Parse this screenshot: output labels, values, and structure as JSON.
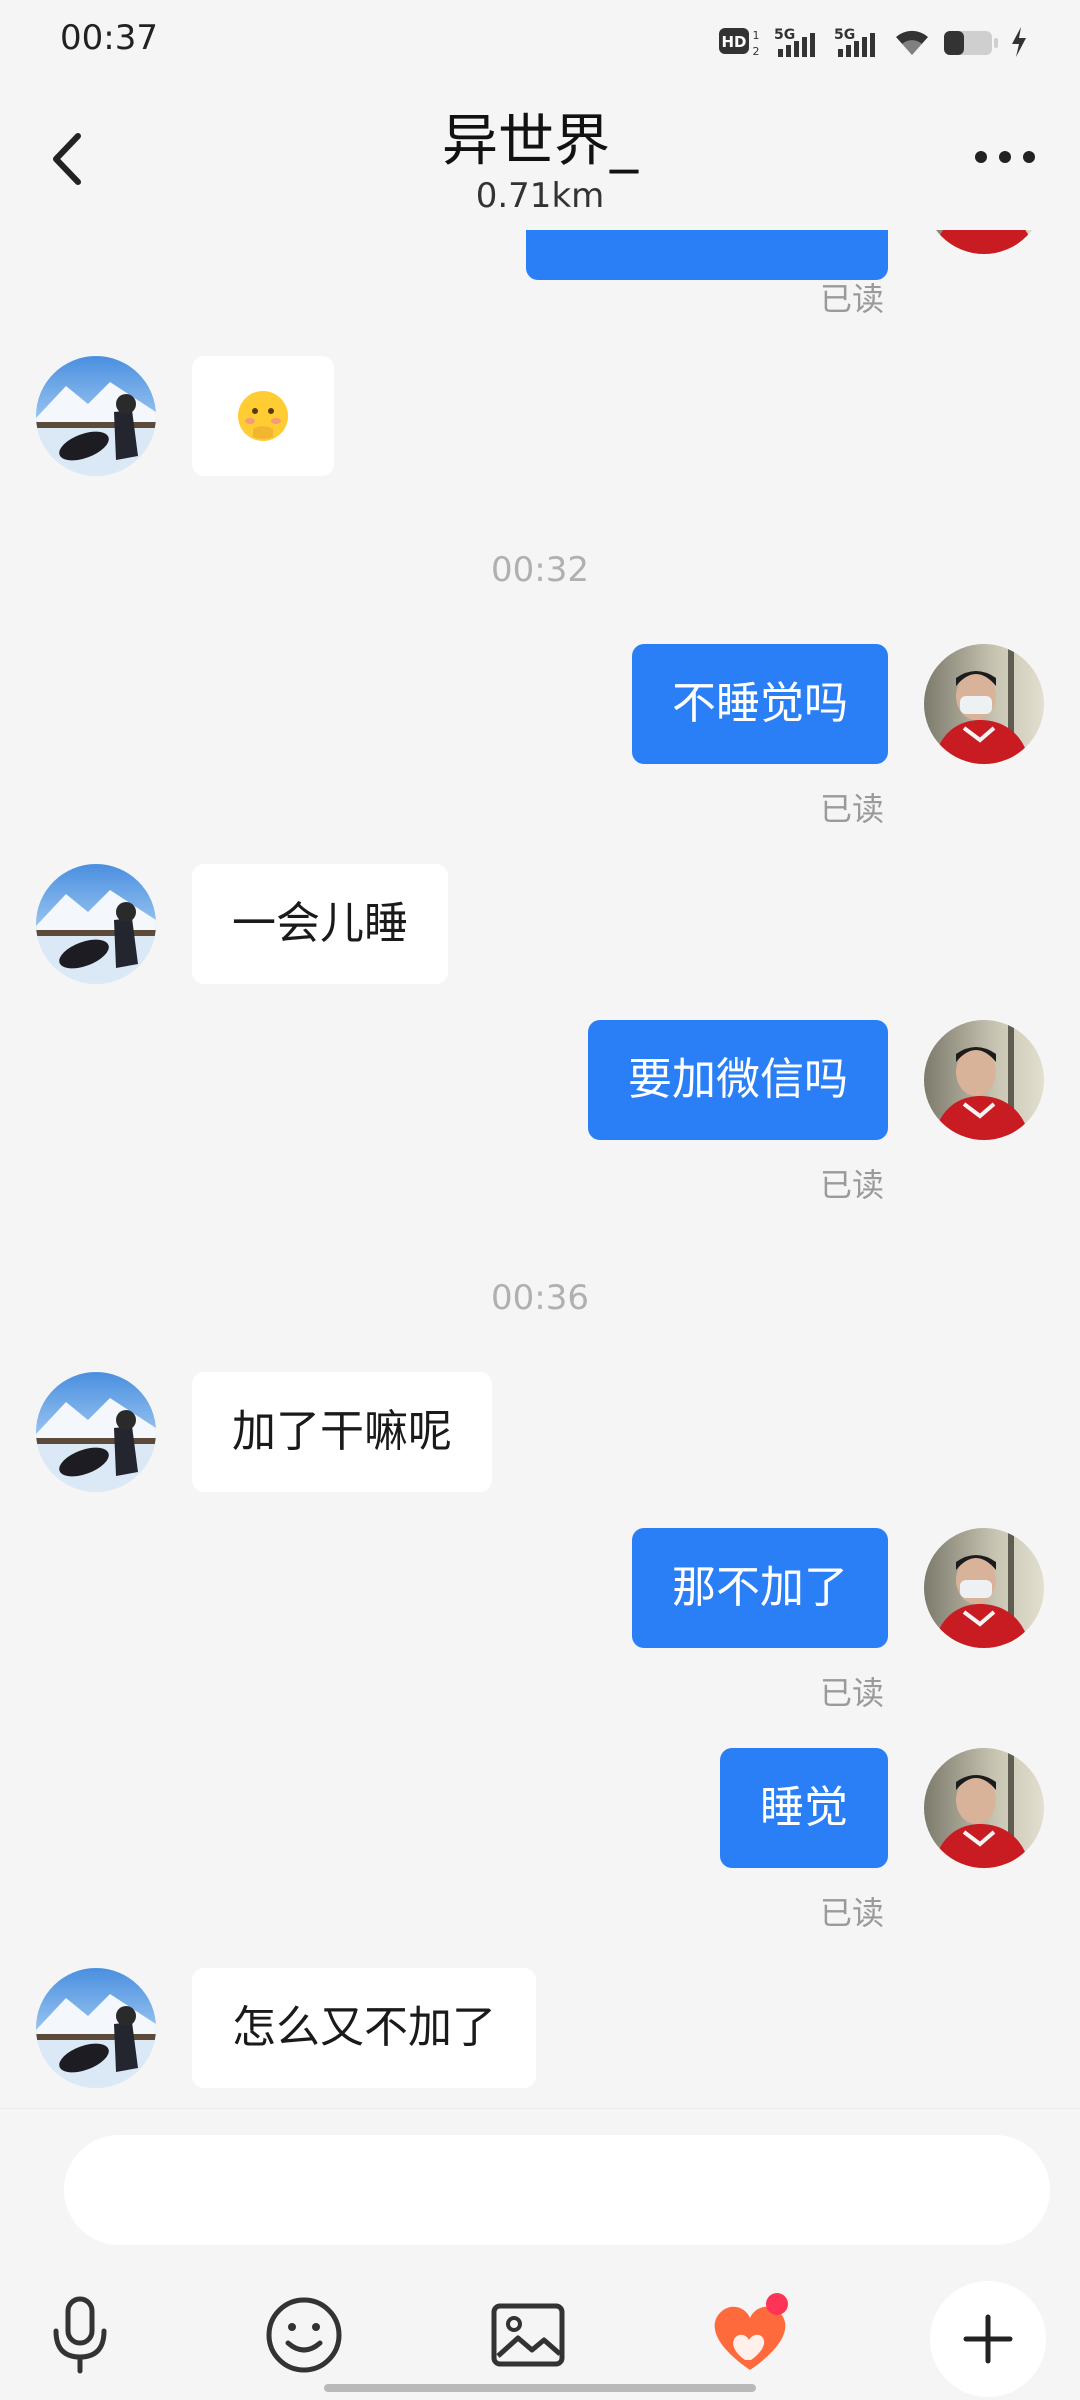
{
  "status_bar": {
    "time": "00:37",
    "icons": [
      "hd-icon",
      "5g-signal-icon",
      "5g-signal-icon",
      "wifi-icon",
      "battery-icon",
      "charging-icon"
    ]
  },
  "header": {
    "title": "异世界_",
    "subtitle": "0.71km"
  },
  "chat": {
    "read_label": "已读",
    "timestamps": [
      "00:32",
      "00:36"
    ],
    "messages": [
      {
        "side": "in",
        "text": "🫢"
      },
      {
        "side": "out",
        "text": "不睡觉吗"
      },
      {
        "side": "in",
        "text": "一会儿睡"
      },
      {
        "side": "out",
        "text": "要加微信吗"
      },
      {
        "side": "in",
        "text": "加了干嘛呢"
      },
      {
        "side": "out",
        "text": "那不加了"
      },
      {
        "side": "out",
        "text": "睡觉"
      },
      {
        "side": "in",
        "text": "怎么又不加了"
      }
    ]
  },
  "composer": {
    "input_value": "",
    "input_placeholder": "",
    "tools": [
      "microphone-icon",
      "emoji-icon",
      "image-icon",
      "heart-gift-icon",
      "plus-icon"
    ],
    "accent": "#2b7ff6",
    "badge_color": "#ff3355",
    "heart_color": "#ff6a3d"
  }
}
